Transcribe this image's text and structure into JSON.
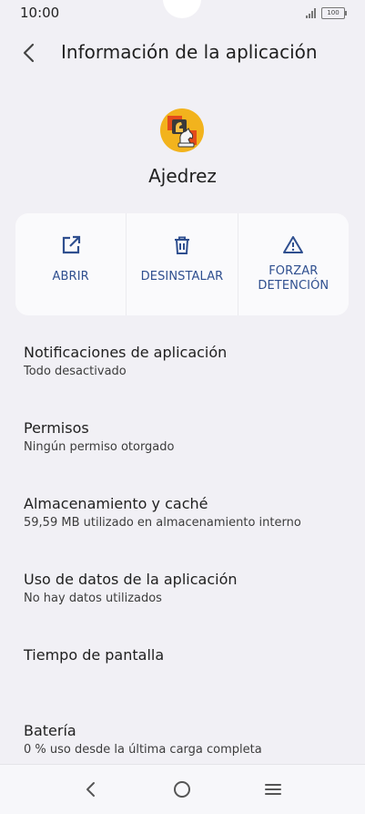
{
  "status_bar": {
    "time": "10:00",
    "battery": "100"
  },
  "header": {
    "title": "Información de la aplicación"
  },
  "app": {
    "name": "Ajedrez"
  },
  "actions": [
    {
      "label": "ABRIR",
      "icon": "open-external-icon"
    },
    {
      "label": "DESINSTALAR",
      "icon": "trash-icon"
    },
    {
      "label_line1": "FORZAR",
      "label_line2": "DETENCIÓN",
      "icon": "warning-triangle-icon"
    }
  ],
  "settings": [
    {
      "title": "Notificaciones de aplicación",
      "subtitle": "Todo desactivado"
    },
    {
      "title": "Permisos",
      "subtitle": "Ningún permiso otorgado"
    },
    {
      "title": "Almacenamiento y caché",
      "subtitle": "59,59 MB utilizado en almacenamiento interno"
    },
    {
      "title": "Uso de datos de la aplicación",
      "subtitle": "No hay datos utilizados"
    },
    {
      "title": "Tiempo de pantalla",
      "subtitle": ""
    },
    {
      "title": "Batería",
      "subtitle": "0 % uso desde la última carga completa"
    }
  ],
  "nav_bar": {
    "back": "back-icon",
    "home": "home-icon",
    "menu": "menu-icon"
  },
  "colors": {
    "background": "#f1f0f5",
    "card": "#fafafc",
    "accent": "#2f4f8f"
  }
}
